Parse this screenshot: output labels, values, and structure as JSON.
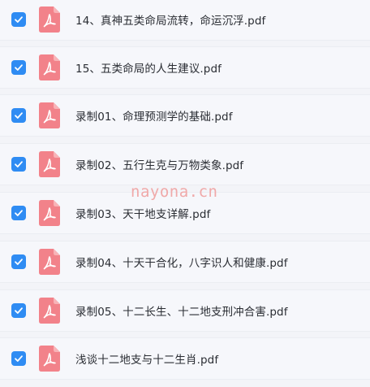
{
  "files": [
    {
      "name": "14、真神五类命局流转，命运沉浮.pdf",
      "checked": true,
      "icon": "pdf-file-icon"
    },
    {
      "name": "15、五类命局的人生建议.pdf",
      "checked": true,
      "icon": "pdf-file-icon"
    },
    {
      "name": "录制01、命理预测学的基础.pdf",
      "checked": true,
      "icon": "pdf-file-icon"
    },
    {
      "name": "录制02、五行生克与万物类象.pdf",
      "checked": true,
      "icon": "pdf-file-icon"
    },
    {
      "name": "录制03、天干地支详解.pdf",
      "checked": true,
      "icon": "pdf-file-icon"
    },
    {
      "name": "录制04、十天干合化，八字识人和健康.pdf",
      "checked": true,
      "icon": "pdf-file-icon"
    },
    {
      "name": "录制05、十二长生、十二地支刑冲合害.pdf",
      "checked": true,
      "icon": "pdf-file-icon"
    },
    {
      "name": "浅谈十二地支与十二生肖.pdf",
      "checked": true,
      "icon": "pdf-file-icon"
    }
  ],
  "watermark": "nayona.cn",
  "colors": {
    "checkbox": "#2f8cf3",
    "pdf_icon_body": "#f2828a",
    "pdf_icon_fold": "#f8b3b7",
    "row_background": "#f6f7fb",
    "page_background": "#f3f4f8",
    "watermark": "#f0a9a9"
  }
}
